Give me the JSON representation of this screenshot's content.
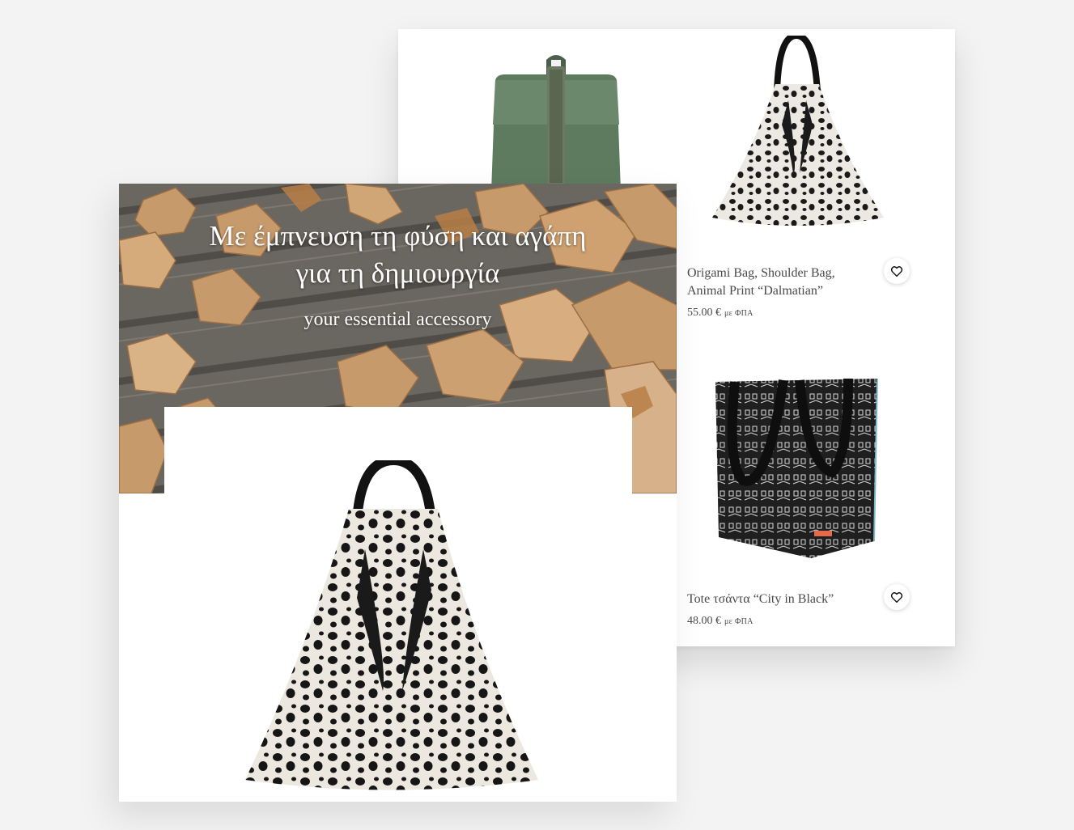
{
  "hero": {
    "title_line1": "Με έμπνευση τη φύση και αγάπη",
    "title_line2": "για τη δημιουργία",
    "subtitle": "your essential accessory"
  },
  "products": [
    {
      "title_line1": "Origami Bag, Shoulder Bag,",
      "title_line2": "Animal Print “Dalmatian”",
      "price": "55.00 €",
      "vat": "με ΦΠΑ",
      "wishlist_icon": "heart-icon"
    },
    {
      "title_line1": "Tote τσάντα “City in Black”",
      "title_line2": "",
      "price": "48.00 €",
      "vat": "με ΦΠΑ",
      "wishlist_icon": "heart-icon"
    }
  ],
  "colors": {
    "page_bg": "#f3f3f3",
    "card_bg": "#ffffff",
    "text": "#4a4a4a",
    "backpack_green": "#5d7a5f"
  }
}
